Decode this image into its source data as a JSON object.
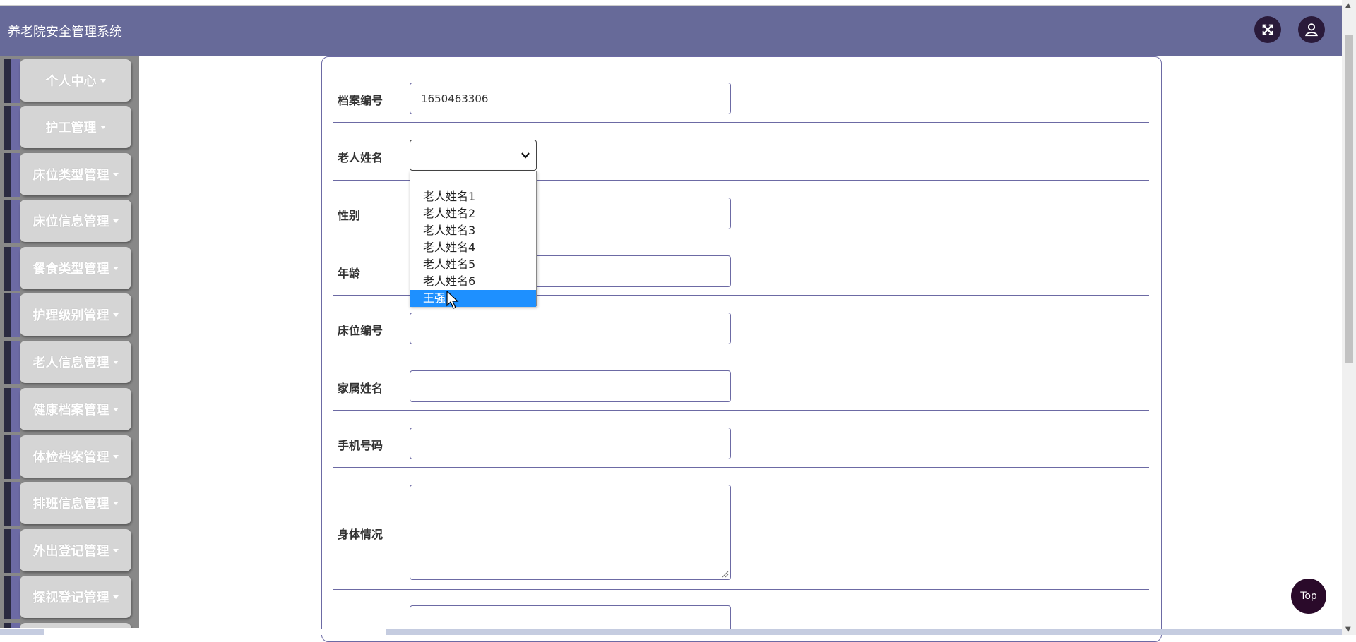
{
  "app_title": "养老院安全管理系统",
  "sidebar": {
    "items": [
      {
        "label": "个人中心"
      },
      {
        "label": "护工管理"
      },
      {
        "label": "床位类型管理"
      },
      {
        "label": "床位信息管理"
      },
      {
        "label": "餐食类型管理"
      },
      {
        "label": "护理级别管理"
      },
      {
        "label": "老人信息管理"
      },
      {
        "label": "健康档案管理"
      },
      {
        "label": "体检档案管理"
      },
      {
        "label": "排班信息管理"
      },
      {
        "label": "外出登记管理"
      },
      {
        "label": "探视登记管理"
      }
    ]
  },
  "form": {
    "fields": [
      {
        "label": "档案编号",
        "value": "1650463306"
      },
      {
        "label": "老人姓名",
        "value": ""
      },
      {
        "label": "性别",
        "value": ""
      },
      {
        "label": "年龄",
        "value": ""
      },
      {
        "label": "床位编号",
        "value": ""
      },
      {
        "label": "家属姓名",
        "value": ""
      },
      {
        "label": "手机号码",
        "value": ""
      },
      {
        "label": "身体情况",
        "value": ""
      }
    ],
    "elder_name_options": [
      "",
      "老人姓名1",
      "老人姓名2",
      "老人姓名3",
      "老人姓名4",
      "老人姓名5",
      "老人姓名6",
      "王强"
    ],
    "highlighted_option": "王强"
  },
  "top_button_label": "Top",
  "icons": {
    "fullscreen": "expand-arrows-icon",
    "user": "user-icon"
  },
  "colors": {
    "header_bg": "#676a99",
    "accent": "#6c6aa4",
    "selected_option": "#1e90ff"
  }
}
